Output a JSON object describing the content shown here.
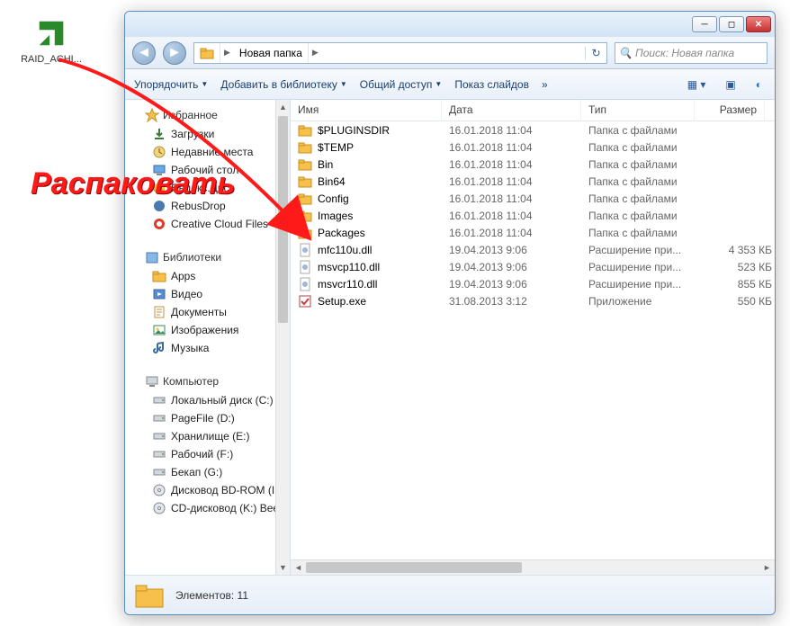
{
  "desktop": {
    "icon_label": "RAID_ACHI..."
  },
  "annotation": {
    "text": "Распаковать"
  },
  "window": {
    "nav": {
      "address_segments": [
        "Новая папка"
      ],
      "search_placeholder": "Поиск: Новая папка"
    },
    "toolbar": {
      "organize": "Упорядочить",
      "add_library": "Добавить в библиотеку",
      "share": "Общий доступ",
      "slideshow": "Показ слайдов",
      "more": "»"
    },
    "sidebar": {
      "favorites": {
        "label": "Избранное",
        "items": [
          {
            "label": "Загрузки",
            "icon": "download"
          },
          {
            "label": "Недавние места",
            "icon": "recent"
          },
          {
            "label": "Рабочий стол",
            "icon": "desktop"
          },
          {
            "label": "Яндекс.Диск",
            "icon": "yadisk"
          },
          {
            "label": "RebusDrop",
            "icon": "rebus"
          },
          {
            "label": "Creative Cloud Files",
            "icon": "cc"
          }
        ]
      },
      "libraries": {
        "label": "Библиотеки",
        "items": [
          {
            "label": "Apps",
            "icon": "folder"
          },
          {
            "label": "Видео",
            "icon": "video"
          },
          {
            "label": "Документы",
            "icon": "docs"
          },
          {
            "label": "Изображения",
            "icon": "images"
          },
          {
            "label": "Музыка",
            "icon": "music"
          }
        ]
      },
      "computer": {
        "label": "Компьютер",
        "items": [
          {
            "label": "Локальный диск (C:)",
            "icon": "hdd"
          },
          {
            "label": "PageFile (D:)",
            "icon": "hdd"
          },
          {
            "label": "Хранилище (E:)",
            "icon": "hdd"
          },
          {
            "label": "Рабочий (F:)",
            "icon": "hdd"
          },
          {
            "label": "Бекап (G:)",
            "icon": "hdd"
          },
          {
            "label": "Дисковод BD-ROM (I",
            "icon": "bd"
          },
          {
            "label": "CD-дисковод (K:) Bee",
            "icon": "cd"
          }
        ]
      }
    },
    "columns": {
      "name": "Имя",
      "date": "Дата",
      "type": "Тип",
      "size": "Размер"
    },
    "files": [
      {
        "name": "$PLUGINSDIR",
        "date": "16.01.2018 11:04",
        "type": "Папка с файлами",
        "size": "",
        "icon": "folder"
      },
      {
        "name": "$TEMP",
        "date": "16.01.2018 11:04",
        "type": "Папка с файлами",
        "size": "",
        "icon": "folder"
      },
      {
        "name": "Bin",
        "date": "16.01.2018 11:04",
        "type": "Папка с файлами",
        "size": "",
        "icon": "folder"
      },
      {
        "name": "Bin64",
        "date": "16.01.2018 11:04",
        "type": "Папка с файлами",
        "size": "",
        "icon": "folder"
      },
      {
        "name": "Config",
        "date": "16.01.2018 11:04",
        "type": "Папка с файлами",
        "size": "",
        "icon": "folder"
      },
      {
        "name": "Images",
        "date": "16.01.2018 11:04",
        "type": "Папка с файлами",
        "size": "",
        "icon": "folder"
      },
      {
        "name": "Packages",
        "date": "16.01.2018 11:04",
        "type": "Папка с файлами",
        "size": "",
        "icon": "folder"
      },
      {
        "name": "mfc110u.dll",
        "date": "19.04.2013 9:06",
        "type": "Расширение при...",
        "size": "4 353 КБ",
        "icon": "dll"
      },
      {
        "name": "msvcp110.dll",
        "date": "19.04.2013 9:06",
        "type": "Расширение при...",
        "size": "523 КБ",
        "icon": "dll"
      },
      {
        "name": "msvcr110.dll",
        "date": "19.04.2013 9:06",
        "type": "Расширение при...",
        "size": "855 КБ",
        "icon": "dll"
      },
      {
        "name": "Setup.exe",
        "date": "31.08.2013 3:12",
        "type": "Приложение",
        "size": "550 КБ",
        "icon": "exe"
      }
    ],
    "status": {
      "count_label": "Элементов: 11"
    }
  }
}
